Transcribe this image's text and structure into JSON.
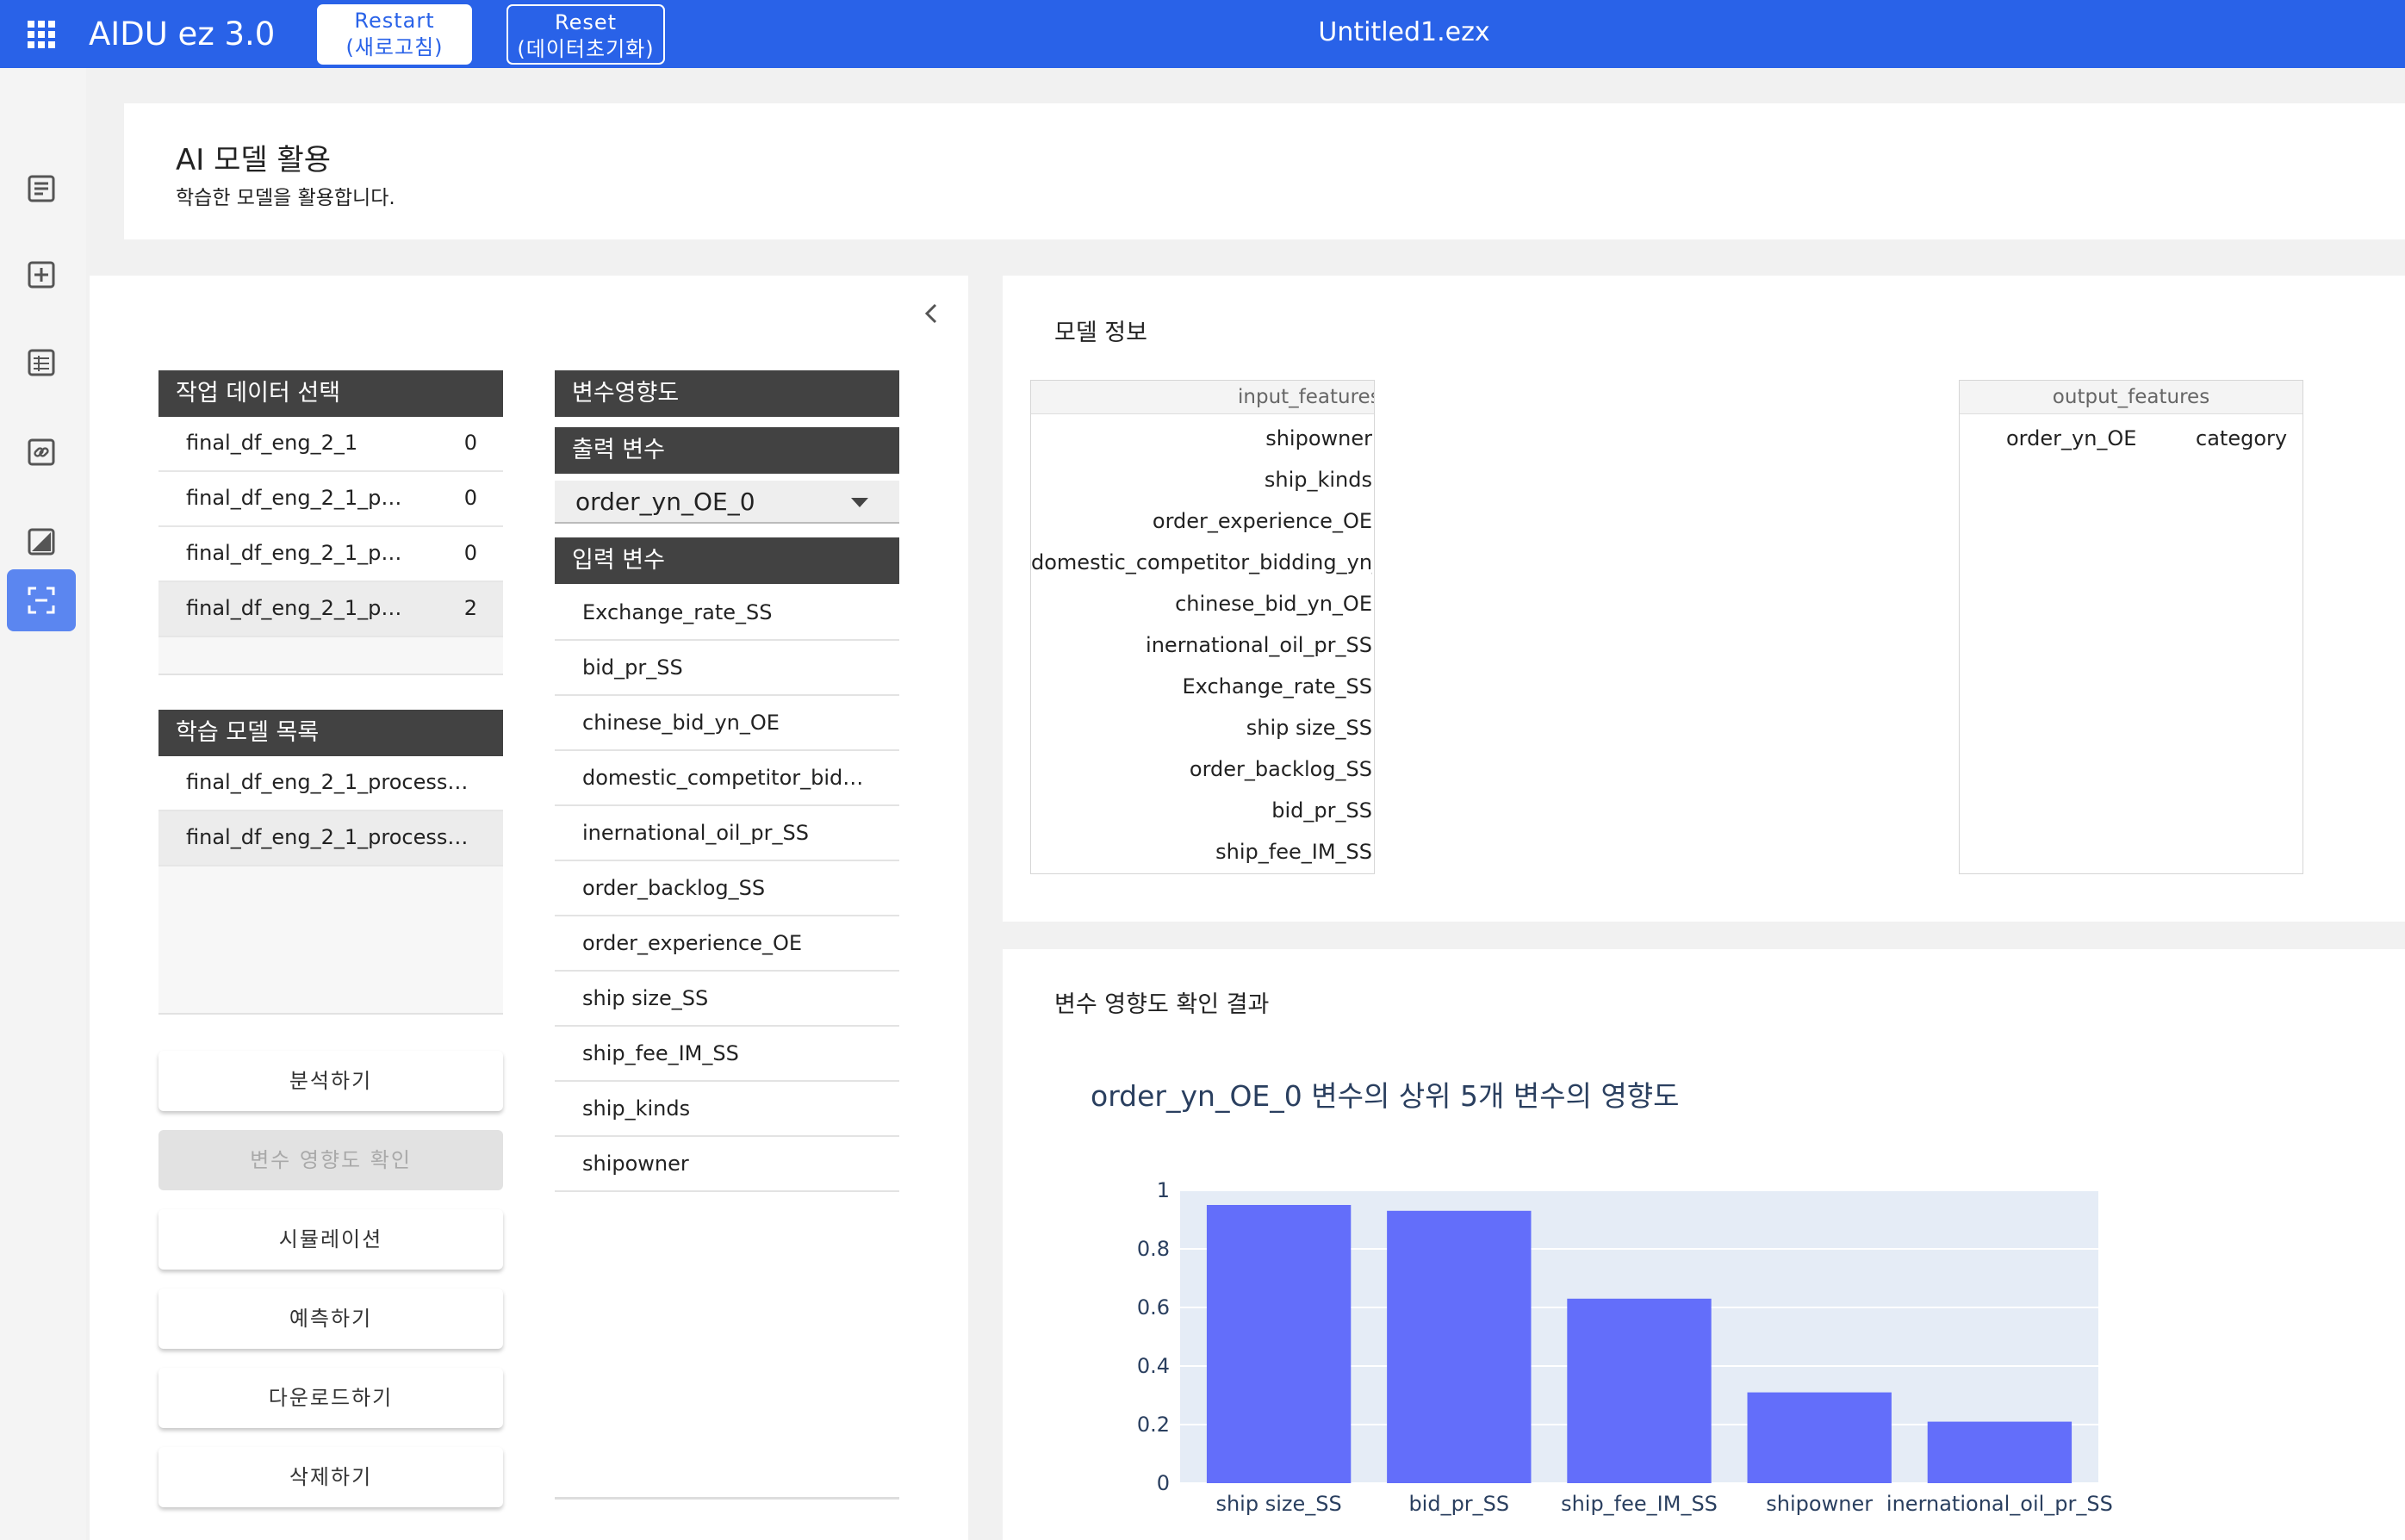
{
  "topbar": {
    "app_title": "AIDU ez 3.0",
    "restart_line1": "Restart",
    "restart_line2": "(새로고침)",
    "reset_line1": "Reset",
    "reset_line2": "(데이터초기화)",
    "file_name": "Untitled1.ezx"
  },
  "sidebar": {
    "items": [
      {
        "icon": "list-box-icon"
      },
      {
        "icon": "plus-box-icon"
      },
      {
        "icon": "table-icon"
      },
      {
        "icon": "link-icon"
      },
      {
        "icon": "chart-box-icon"
      },
      {
        "icon": "scan-focus-icon",
        "active": true
      }
    ]
  },
  "header": {
    "title": "AI 모델 활용",
    "subtitle": "학습한 모델을 활용합니다."
  },
  "data_select": {
    "header": "작업 데이터 선택",
    "items": [
      {
        "name": "final_df_eng_2_1",
        "count": "0"
      },
      {
        "name": "final_df_eng_2_1_p…",
        "count": "0"
      },
      {
        "name": "final_df_eng_2_1_p…",
        "count": "0"
      },
      {
        "name": "final_df_eng_2_1_p…",
        "count": "2"
      }
    ]
  },
  "model_list": {
    "header": "학습 모델 목록",
    "items": [
      {
        "name": "final_df_eng_2_1_process…"
      },
      {
        "name": "final_df_eng_2_1_process…"
      }
    ]
  },
  "actions": {
    "analyze": "분석하기",
    "importance": "변수 영향도 확인",
    "simulate": "시뮬레이션",
    "predict": "예측하기",
    "download": "다운로드하기",
    "delete": "삭제하기"
  },
  "importance_panel": {
    "header": "변수영향도",
    "output_header": "출력 변수",
    "output_selected": "order_yn_OE_0",
    "input_header": "입력 변수",
    "input_vars": [
      "Exchange_rate_SS",
      "bid_pr_SS",
      "chinese_bid_yn_OE",
      "domestic_competitor_bid…",
      "inernational_oil_pr_SS",
      "order_backlog_SS",
      "order_experience_OE",
      "ship size_SS",
      "ship_fee_IM_SS",
      "ship_kinds",
      "shipowner"
    ]
  },
  "model_info": {
    "title": "모델 정보",
    "input_header": "input_features",
    "input_rows": [
      "shipowner",
      "ship_kinds",
      "order_experience_OE",
      "domestic_competitor_bidding_yn_OE",
      "chinese_bid_yn_OE",
      "inernational_oil_pr_SS",
      "Exchange_rate_SS",
      "ship size_SS",
      "order_backlog_SS",
      "bid_pr_SS",
      "ship_fee_IM_SS"
    ],
    "output_header": "output_features",
    "output_rows": [
      {
        "name": "order_yn_OE",
        "type": "category"
      }
    ]
  },
  "importance_result": {
    "title": "변수 영향도 확인 결과",
    "chart_title_var": "order_yn_OE_0",
    "chart_title_rest": " 변수의 상위 5개 변수의 영향도"
  },
  "colors": {
    "topbar": "#2962e8",
    "bar": "#636efa",
    "plot_bg": "#e5ecf6"
  },
  "chart_data": {
    "type": "bar",
    "categories": [
      "ship size_SS",
      "bid_pr_SS",
      "ship_fee_IM_SS",
      "shipowner",
      "inernational_oil_pr_SS"
    ],
    "values": [
      0.95,
      0.93,
      0.63,
      0.31,
      0.21
    ],
    "ylim": [
      0,
      1
    ],
    "yticks": [
      "0",
      "0.2",
      "0.4",
      "0.6",
      "0.8",
      "1"
    ],
    "title": "order_yn_OE_0 변수의 상위 5개 변수의 영향도",
    "xlabel": "",
    "ylabel": "",
    "grid": true,
    "legend": "none"
  }
}
